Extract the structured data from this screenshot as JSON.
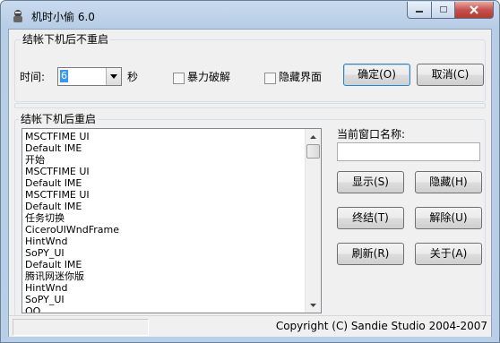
{
  "window": {
    "title": "机时小偷 6.0"
  },
  "top_group": {
    "label": "结帐下机后不重启",
    "time_label": "时间:",
    "time_value": "6",
    "seconds_label": "秒",
    "force_crack_label": "暴力破解",
    "force_crack_checked": false,
    "hide_ui_label": "隐藏界面",
    "hide_ui_checked": false,
    "ok_button": "确定(O)",
    "cancel_button": "取消(C)"
  },
  "bottom_group": {
    "label": "结帐下机后重启",
    "window_list": [
      "MSCTFIME UI",
      "Default IME",
      "开始",
      "MSCTFIME UI",
      "Default IME",
      "MSCTFIME UI",
      "Default IME",
      "任务切换",
      "CiceroUIWndFrame",
      "HintWnd",
      "SoPY_UI",
      "Default IME",
      "腾讯网迷你版",
      "HintWnd",
      "SoPY_UI",
      "QQ"
    ],
    "current_window_label": "当前窗口名称:",
    "current_window_value": "",
    "show_button": "显示(S)",
    "hide_button": "隐藏(H)",
    "terminate_button": "终结(T)",
    "unlock_button": "解除(U)",
    "refresh_button": "刷新(R)",
    "about_button": "关于(A)"
  },
  "status": {
    "copyright": "Copyright (C) Sandie Studio 2004-2007"
  },
  "colors": {
    "selection": "#3399ff",
    "close_button": "#c75050",
    "title_bar": "#b9cfe8"
  }
}
